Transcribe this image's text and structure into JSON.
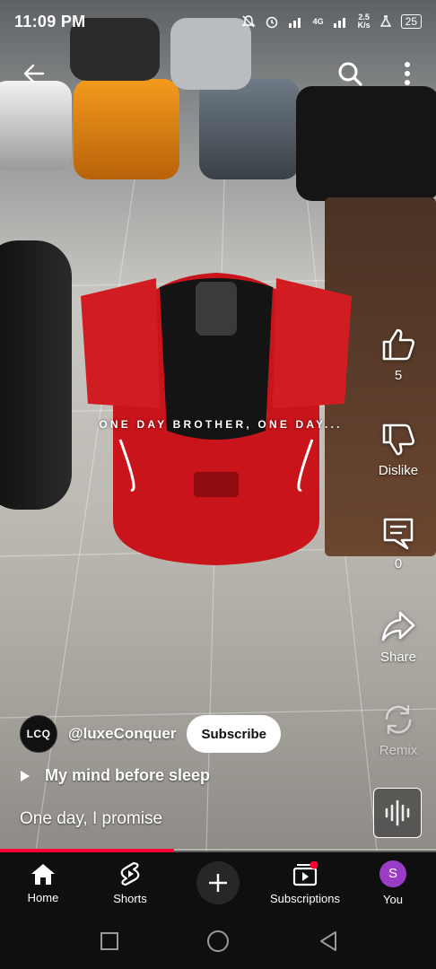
{
  "status_bar": {
    "time": "11:09 PM",
    "net_speed_value": "2.5",
    "net_speed_unit": "K/s",
    "network_label": "4G",
    "battery": "25"
  },
  "overlay_caption": "ONE DAY BROTHER, ONE DAY...",
  "actions": {
    "like_count": "5",
    "dislike_label": "Dislike",
    "comments_count": "0",
    "share_label": "Share",
    "remix_label": "Remix"
  },
  "channel": {
    "avatar_text": "LCQ",
    "handle": "@luxeConquer",
    "subscribe_label": "Subscribe"
  },
  "sound": {
    "title": "My mind before sleep"
  },
  "video_title": "One day, I promise",
  "progress": {
    "fraction": 0.4
  },
  "bottom_nav": {
    "home": "Home",
    "shorts": "Shorts",
    "subscriptions": "Subscriptions",
    "you": "You",
    "you_avatar": "S"
  },
  "colors": {
    "accent": "#ff0033",
    "nav_bg": "#0f0f0f",
    "you_avatar_bg": "#9b3cc6",
    "car_red": "#c8141a"
  },
  "icons": [
    "back-arrow-icon",
    "search-icon",
    "more-vert-icon",
    "like-icon",
    "dislike-icon",
    "comment-icon",
    "share-icon",
    "remix-icon",
    "play-icon",
    "audio-wave-icon",
    "home-icon",
    "shorts-icon",
    "plus-icon",
    "subscriptions-icon",
    "square-icon",
    "circle-icon",
    "triangle-back-icon"
  ]
}
